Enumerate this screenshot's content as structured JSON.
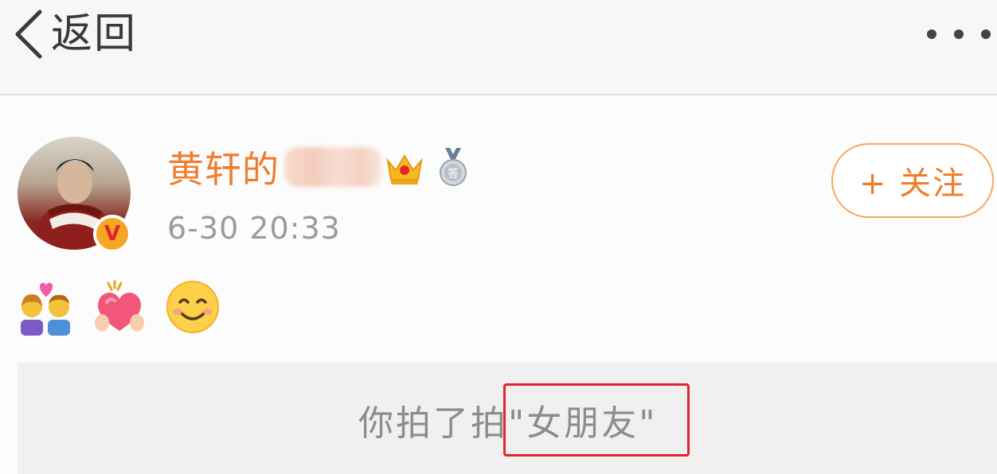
{
  "nav": {
    "back_label": "返回",
    "back_icon": "chevron-left-icon",
    "more_icon": "more-icon"
  },
  "post": {
    "username": "黄轩的",
    "badges": [
      "crown-icon",
      "medal-icon"
    ],
    "verified_icon": "v-badge-icon",
    "verified_text": "V",
    "time": "6-30 20:33",
    "emojis": [
      "couple-with-heart-icon",
      "heart-hands-icon",
      "smiling-face-icon"
    ],
    "follow_label": "+ 关注"
  },
  "repost": {
    "prefix": "你拍了拍",
    "quoted": "\"女朋友\""
  },
  "colors": {
    "accent": "#ef7d2d",
    "highlight": "#e0262b",
    "muted_text": "#9a9a9a"
  }
}
